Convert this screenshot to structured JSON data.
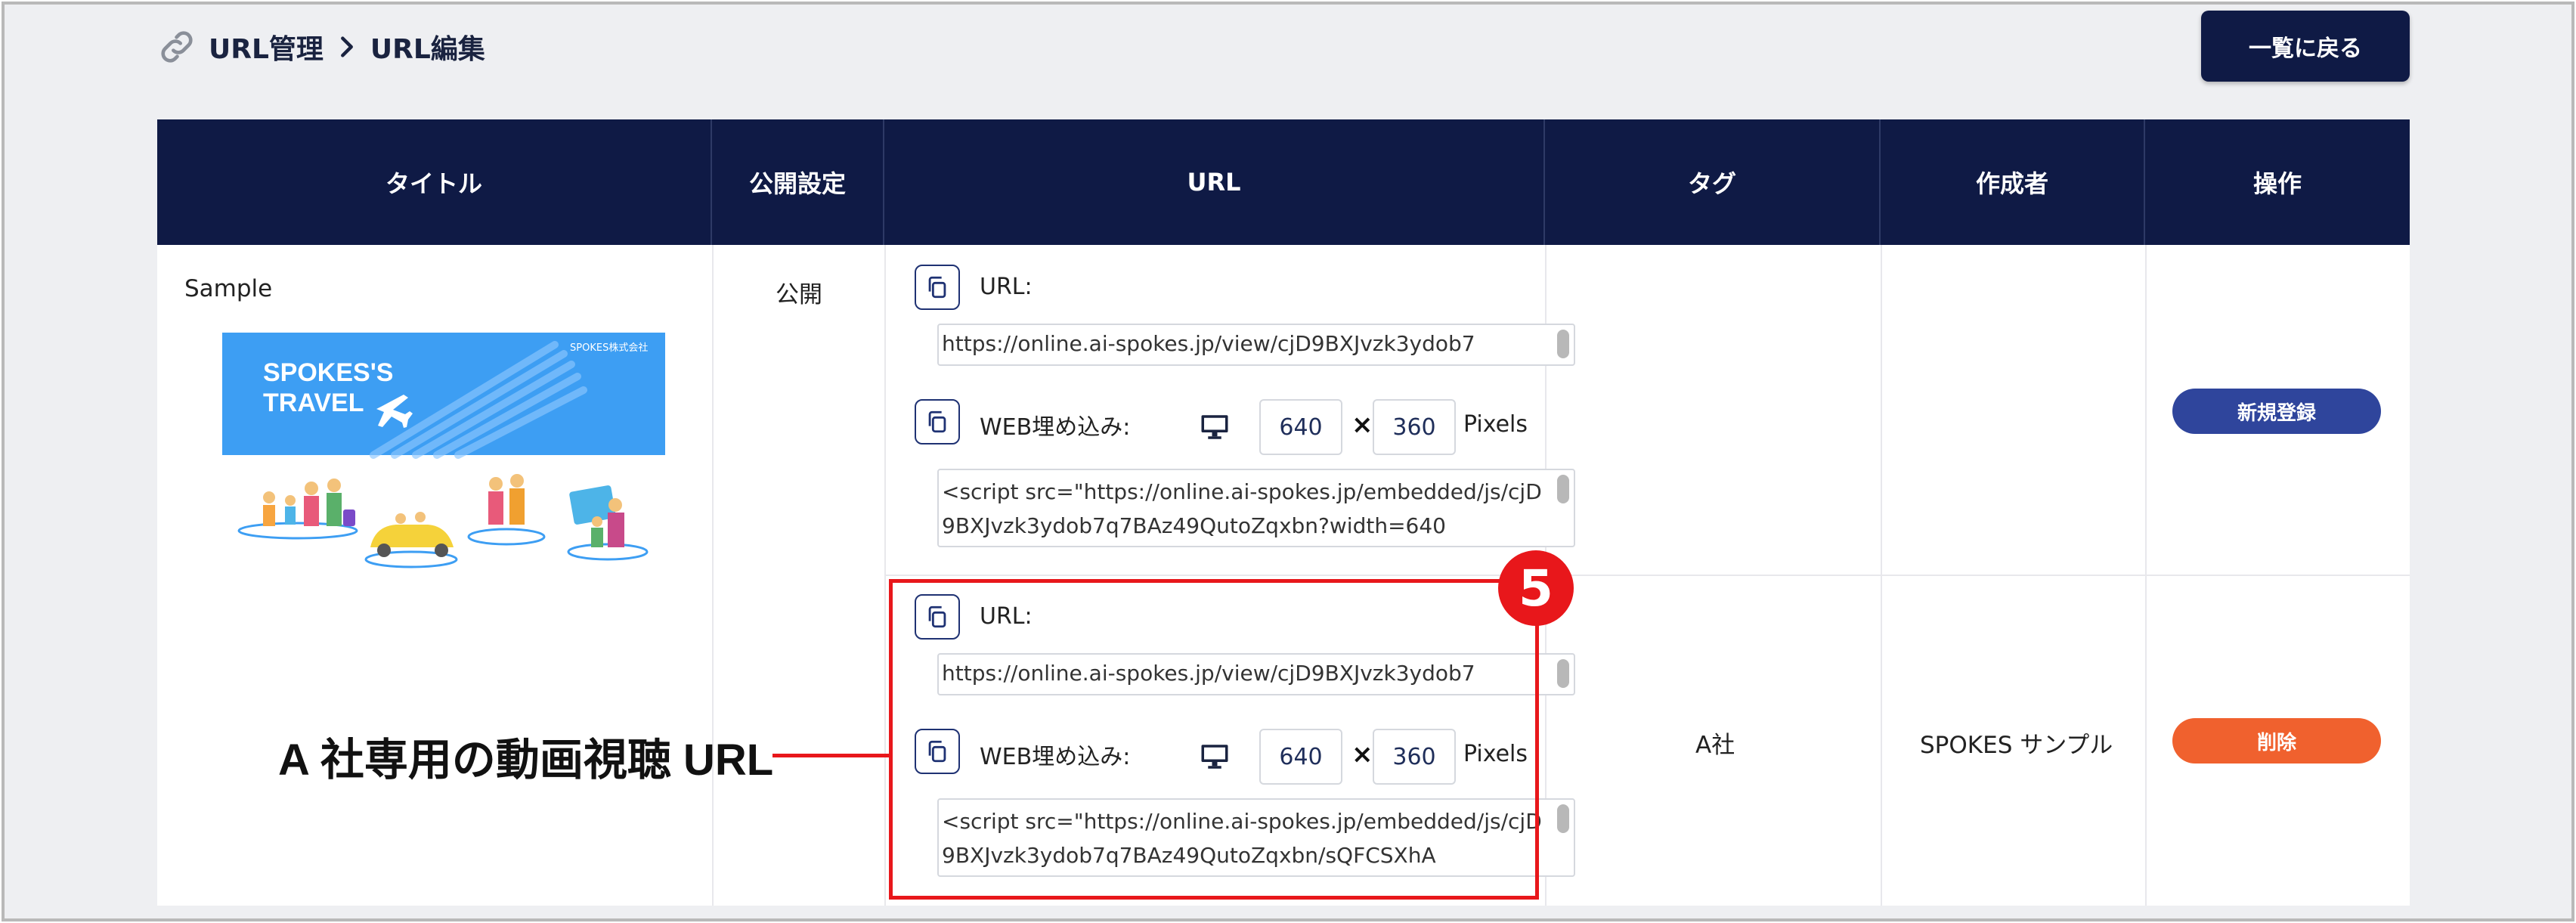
{
  "header": {
    "breadcrumb": [
      "URL管理",
      "URL編集"
    ],
    "back_button_label": "一覧に戻る"
  },
  "table": {
    "columns": [
      "タイトル",
      "公開設定",
      "URL",
      "タグ",
      "作成者",
      "操作"
    ],
    "row": {
      "title": "Sample",
      "visibility": "公開",
      "thumbnail": {
        "banner_title_line1": "SPOKES'S",
        "banner_title_line2": "TRAVEL",
        "banner_company": "SPOKES株式会社"
      },
      "entries": [
        {
          "url_label": "URL:",
          "url_value": "https://online.ai-spokes.jp/view/cjD9BXJvzk3ydob7",
          "embed_label": "WEB埋め込み:",
          "width": "640",
          "height": "360",
          "times": "×",
          "pixels_label": "Pixels",
          "embed_code": "<script src=\"https://online.ai-spokes.jp/embedded/js/cjD9BXJvzk3ydob7q7BAz49QutoZqxbn?width=640",
          "tag": "",
          "author": "",
          "action_label": "新規登録",
          "action_color": "#2f459c"
        },
        {
          "url_label": "URL:",
          "url_value": "https://online.ai-spokes.jp/view/cjD9BXJvzk3ydob7",
          "embed_label": "WEB埋め込み:",
          "width": "640",
          "height": "360",
          "times": "×",
          "pixels_label": "Pixels",
          "embed_code": "<script src=\"https://online.ai-spokes.jp/embedded/js/cjD9BXJvzk3ydob7q7BAz49QutoZqxbn/sQFCSXhA",
          "tag": "A社",
          "author": "SPOKES サンプル",
          "action_label": "削除",
          "action_color": "#f0612e"
        }
      ]
    }
  },
  "annotation": {
    "badge_number": "5",
    "callout_text": "A 社専用の動画視聴 URL",
    "color": "#e8171b"
  },
  "colors": {
    "header_navy": "#0f1a45",
    "page_bg": "#eeeff2"
  }
}
